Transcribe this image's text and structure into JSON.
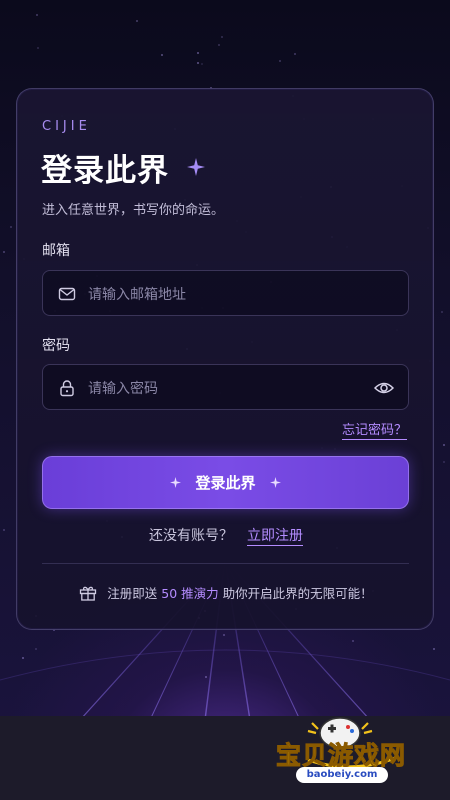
{
  "brand": "CIJIE",
  "title": "登录此界",
  "subtitle": "进入任意世界，书写你的命运。",
  "email": {
    "label": "邮箱",
    "placeholder": "请输入邮箱地址"
  },
  "password": {
    "label": "密码",
    "placeholder": "请输入密码"
  },
  "forgot_label": "忘记密码？",
  "login_button_label": "登录此界",
  "register": {
    "prompt": "还没有账号？",
    "link_label": "立即注册"
  },
  "promo": {
    "prefix": "注册即送",
    "highlight": "50 推演力",
    "suffix": "助你开启此界的无限可能！"
  },
  "watermark": {
    "title": "宝贝游戏网",
    "url": "baobeiy.com"
  },
  "colors": {
    "accent": "#7a4ce6",
    "link": "#b48cff",
    "background": "#120f2a"
  }
}
